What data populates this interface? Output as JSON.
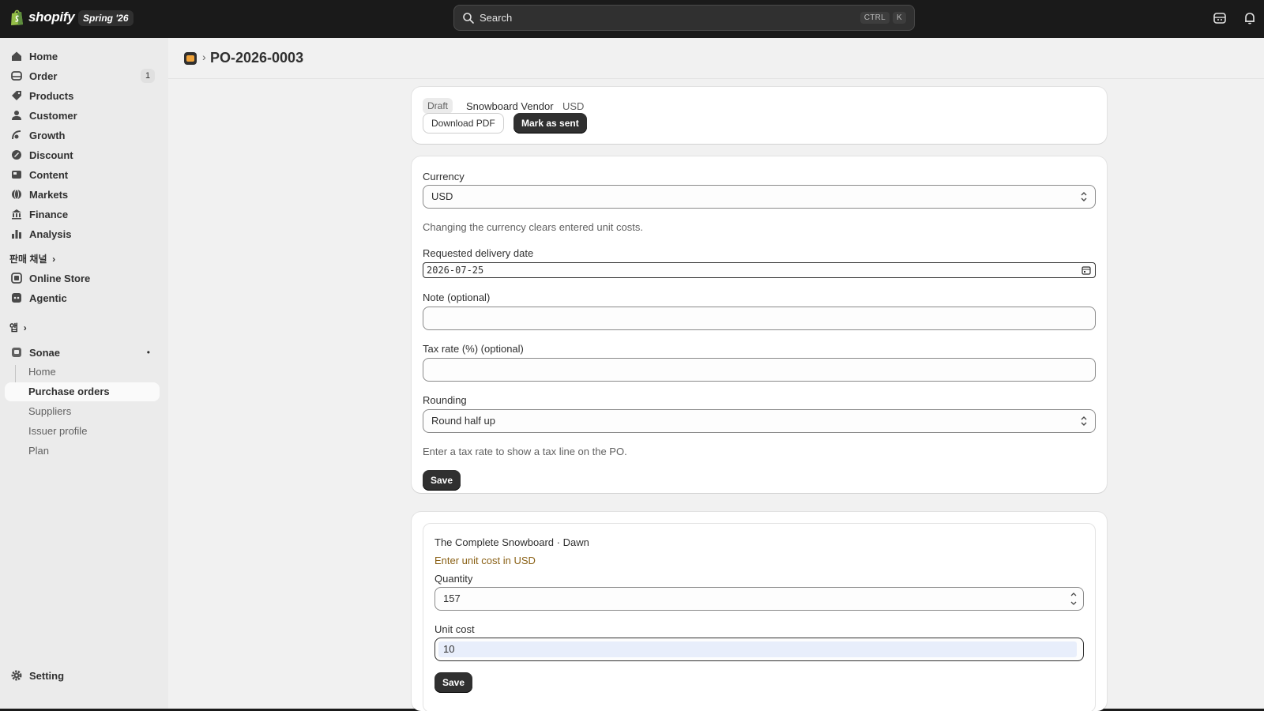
{
  "topbar": {
    "logo_text": "shopify",
    "season_badge": "Spring '26",
    "search_label": "Search",
    "shortcut_ctrl": "CTRL",
    "shortcut_key": "K"
  },
  "sidebar": {
    "items": [
      {
        "label": "Home",
        "icon": "home-icon"
      },
      {
        "label": "Order",
        "icon": "inbox-icon",
        "badge": "1"
      },
      {
        "label": "Products",
        "icon": "tag-icon"
      },
      {
        "label": "Customer",
        "icon": "person-icon"
      },
      {
        "label": "Growth",
        "icon": "growth-icon"
      },
      {
        "label": "Discount",
        "icon": "discount-icon"
      },
      {
        "label": "Content",
        "icon": "content-icon"
      },
      {
        "label": "Markets",
        "icon": "globe-icon"
      },
      {
        "label": "Finance",
        "icon": "bank-icon"
      },
      {
        "label": "Analysis",
        "icon": "chart-icon"
      }
    ],
    "sales_channels_heading": "판매 채널",
    "channels": [
      {
        "label": "Online Store",
        "icon": "store-icon"
      },
      {
        "label": "Agentic",
        "icon": "agentic-icon"
      }
    ],
    "apps_heading": "앱",
    "app_name": "Sonae",
    "app_subitems": [
      "Home",
      "Purchase orders",
      "Suppliers",
      "Issuer profile",
      "Plan"
    ],
    "settings_label": "Setting"
  },
  "page": {
    "title": "PO-2026-0003"
  },
  "summary": {
    "status": "Draft",
    "vendor": "Snowboard Vendor",
    "currency": "USD",
    "download_label": "Download PDF",
    "mark_sent_label": "Mark as sent"
  },
  "settings_form": {
    "currency_label": "Currency",
    "currency_value": "USD",
    "currency_help": "Changing the currency clears entered unit costs.",
    "delivery_label": "Requested delivery date",
    "delivery_value": "2026-07-25",
    "note_label": "Note (optional)",
    "note_value": "",
    "tax_label": "Tax rate (%) (optional)",
    "tax_value": "",
    "rounding_label": "Rounding",
    "rounding_value": "Round half up",
    "tax_help": "Enter a tax rate to show a tax line on the PO.",
    "save_label": "Save"
  },
  "line_item": {
    "product": "The Complete Snowboard · Dawn",
    "warning": "Enter unit cost in USD",
    "quantity_label": "Quantity",
    "quantity_value": "157",
    "unit_cost_label": "Unit cost",
    "unit_cost_value": "10",
    "save_label": "Save"
  },
  "colors": {
    "topbar": "#1a1a1a",
    "surface": "#f1f1f1",
    "primary_button": "#303030",
    "warning_text": "#8a6116"
  }
}
